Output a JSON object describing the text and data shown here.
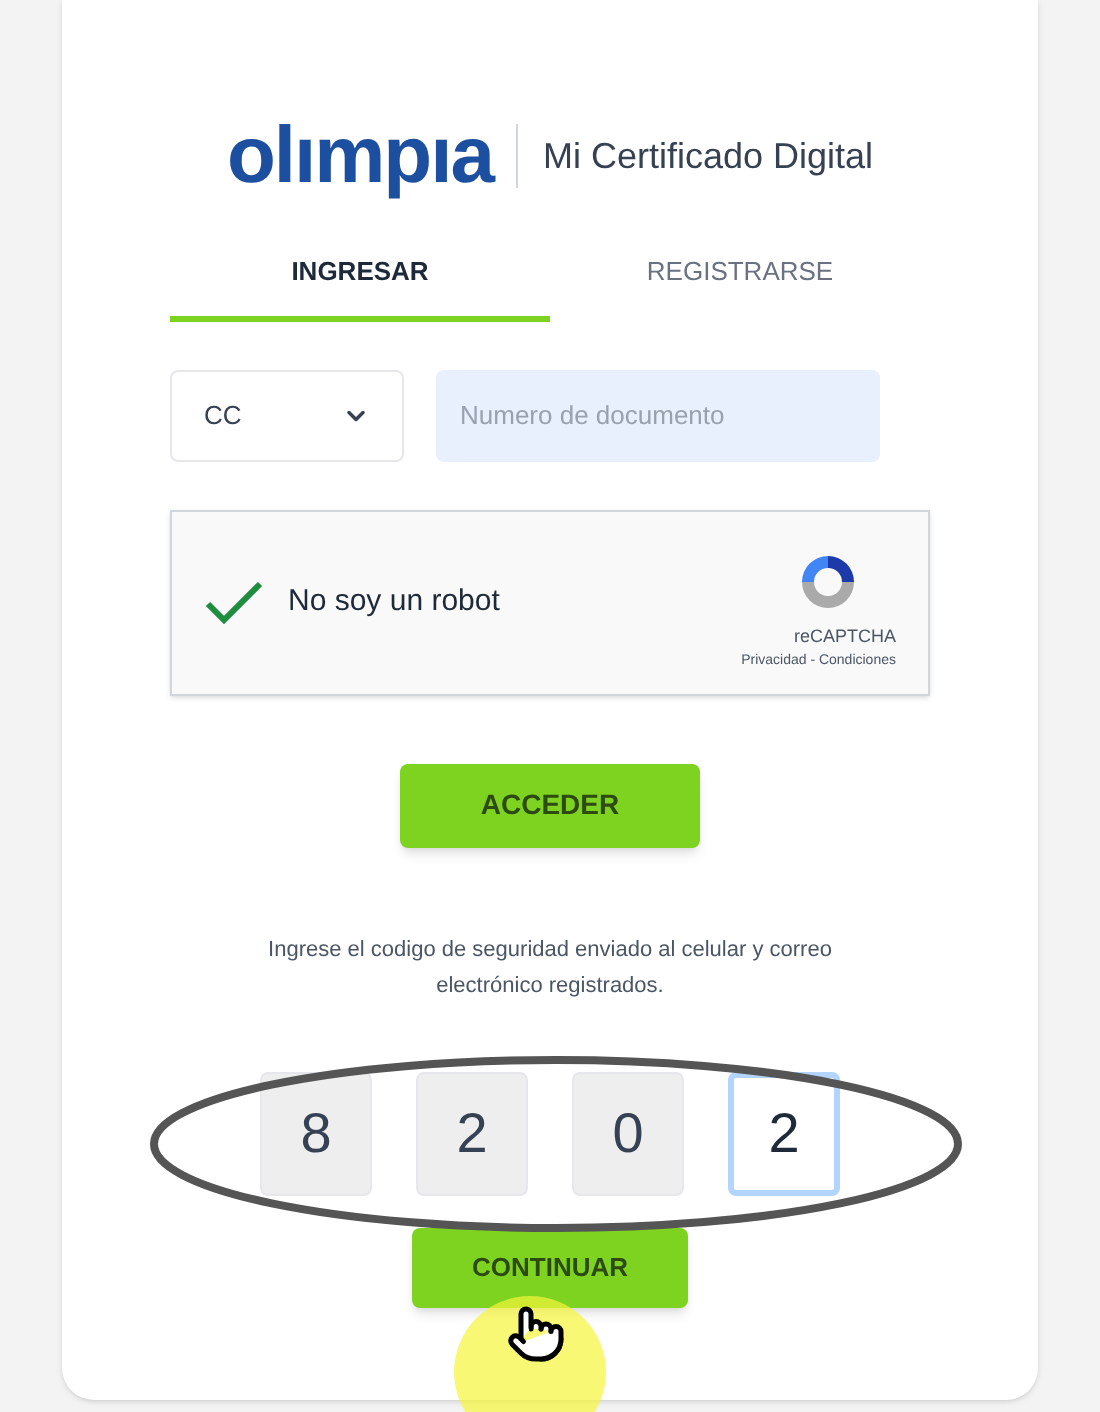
{
  "brand": {
    "logo": "olımpıa",
    "product": "Mi Certificado Digital"
  },
  "tabs": [
    {
      "label": "INGRESAR",
      "selected": true
    },
    {
      "label": "REGISTRARSE",
      "selected": false
    }
  ],
  "document": {
    "type": "CC",
    "placeholder": "Numero de documento"
  },
  "captcha": {
    "label": "No soy un robot",
    "checked": true,
    "brand": "reCAPTCHA",
    "links": "Privacidad - Condiciones"
  },
  "access_button": "ACCEDER",
  "code_prompt": "Ingrese el codigo de seguridad enviado al celular y correo electrónico registrados.",
  "code_digits": [
    {
      "value": "8",
      "selected": false
    },
    {
      "value": "2",
      "selected": false
    },
    {
      "value": "0",
      "selected": false
    },
    {
      "value": "2",
      "selected": true
    }
  ],
  "continue_button": "CONTINUAR"
}
